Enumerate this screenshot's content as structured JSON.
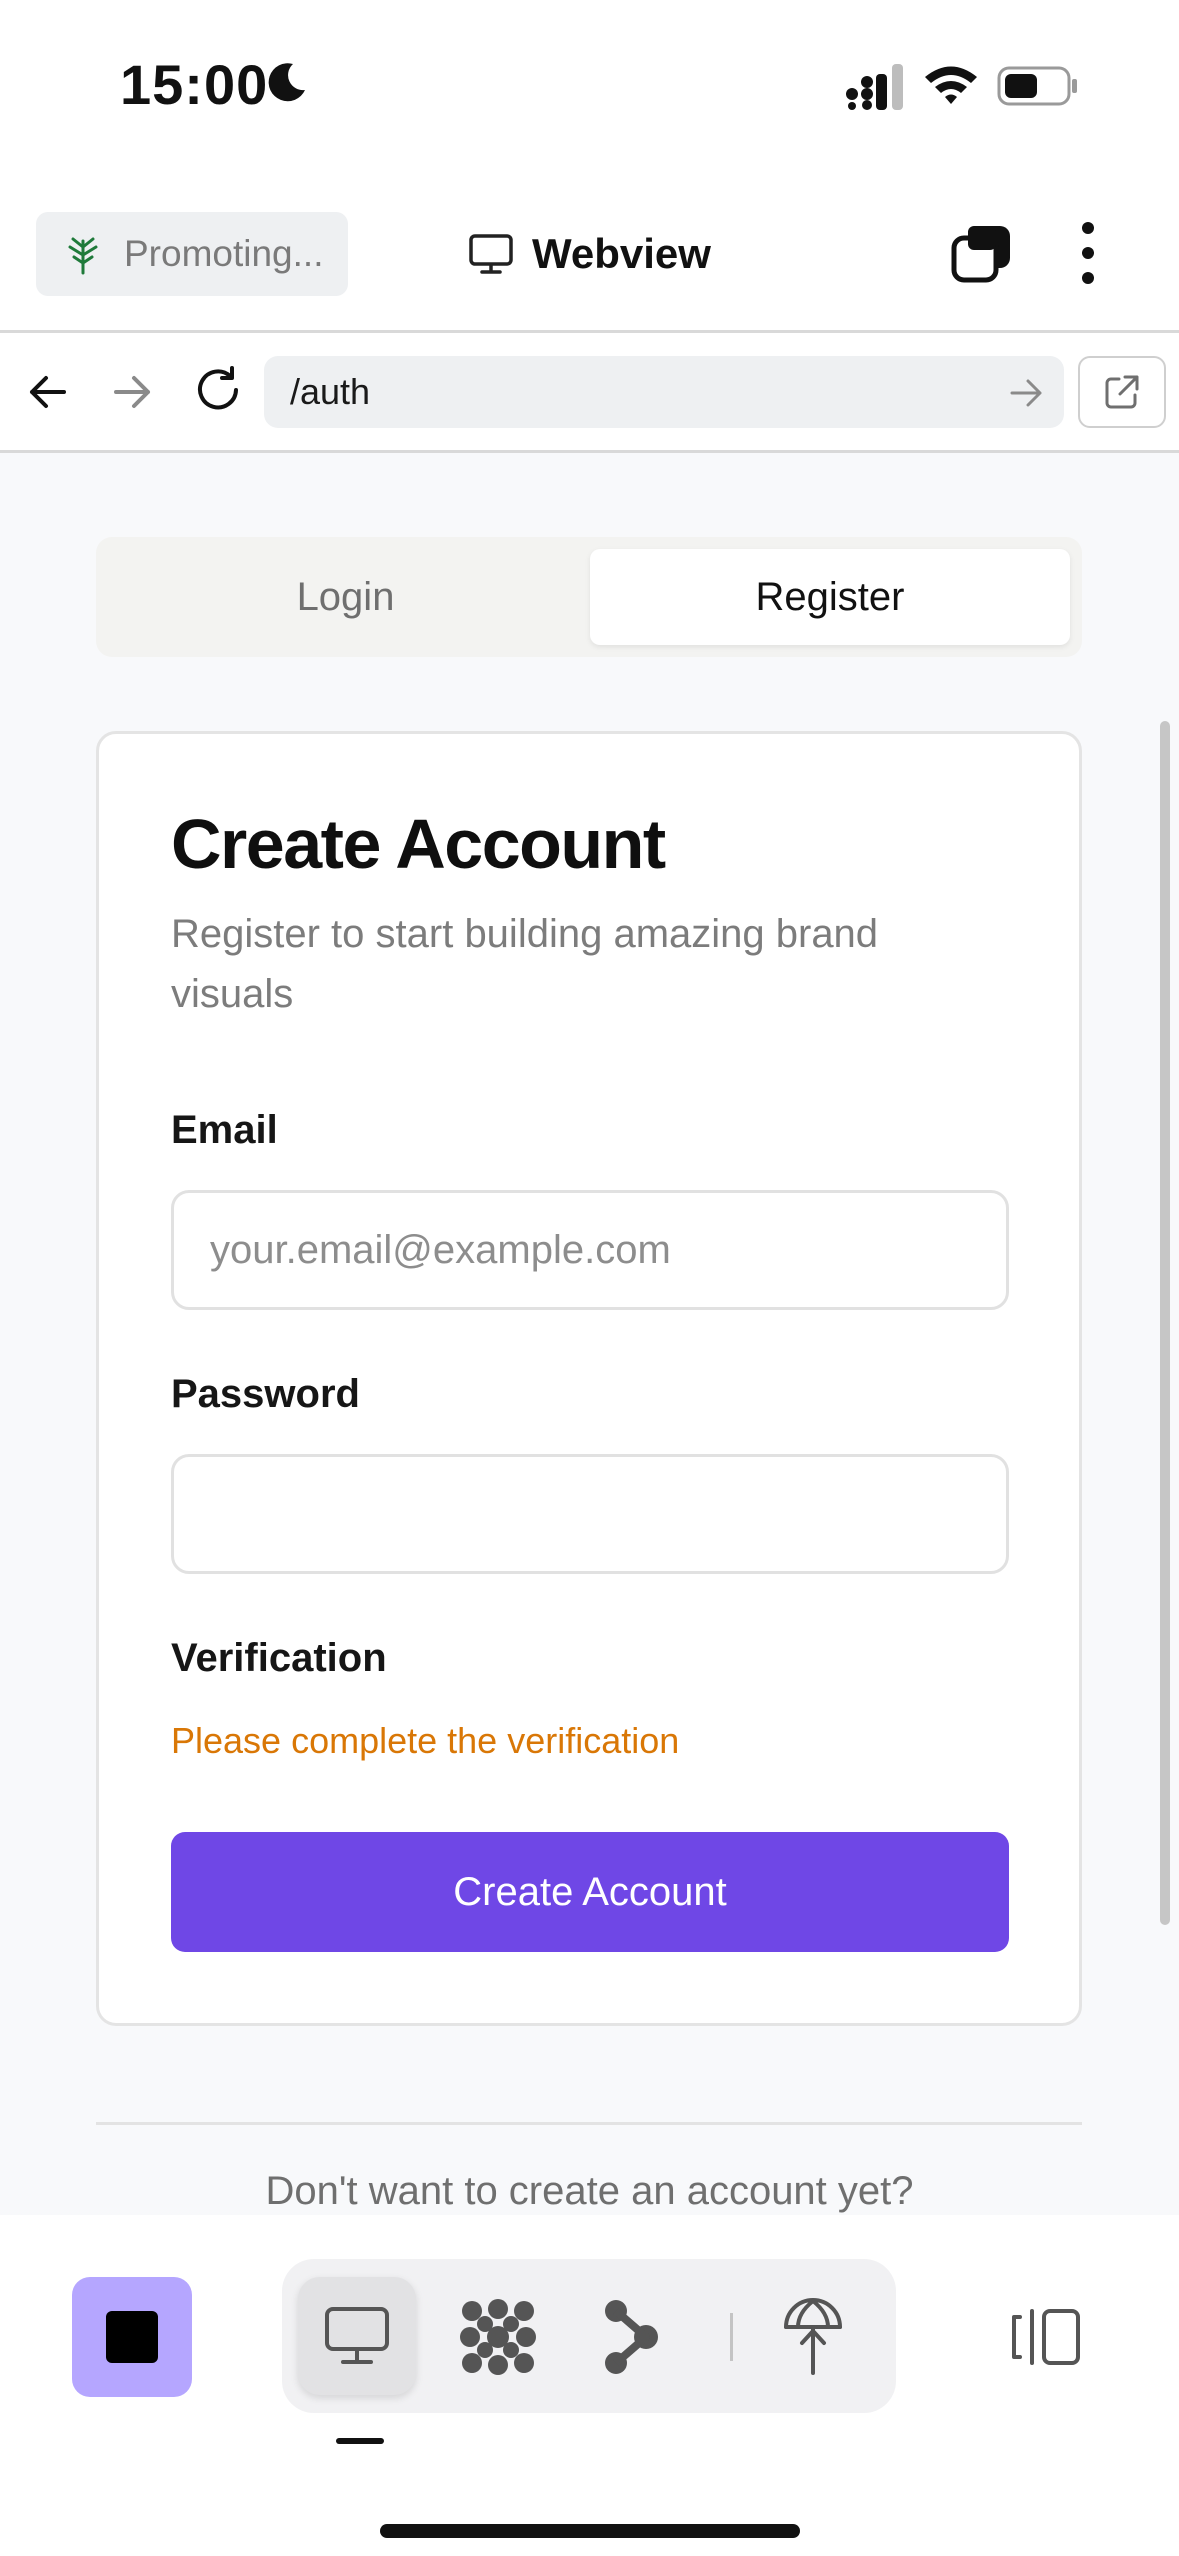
{
  "status_bar": {
    "time": "15:00",
    "icons": [
      "moon-icon",
      "signal-icon",
      "wifi-icon",
      "battery-icon"
    ]
  },
  "toolbar": {
    "promo_label": "Promoting...",
    "promo_icon": "tree-icon",
    "title": "Webview",
    "title_icon": "monitor-icon",
    "tabs_icon": "tabs-icon",
    "more_icon": "more-vertical-icon"
  },
  "url_bar": {
    "url": "/auth",
    "back_icon": "arrow-left-icon",
    "forward_icon": "arrow-right-icon",
    "reload_icon": "reload-icon",
    "go_icon": "arrow-right-icon",
    "external_icon": "external-link-icon"
  },
  "auth": {
    "tabs": [
      {
        "label": "Login",
        "active": false
      },
      {
        "label": "Register",
        "active": true
      }
    ],
    "card": {
      "title": "Create Account",
      "subtitle": "Register to start building amazing brand visuals",
      "email_label": "Email",
      "email_placeholder": "your.email@example.com",
      "email_value": "",
      "password_label": "Password",
      "password_value": "",
      "verification_label": "Verification",
      "verification_warning": "Please complete the verification",
      "submit_label": "Create Account"
    },
    "guest_prompt": "Don't want to create an account yet?"
  },
  "dock": {
    "stop_icon": "stop-icon",
    "modes": [
      {
        "icon": "monitor-icon",
        "active": true
      },
      {
        "icon": "grid-dots-icon",
        "active": false
      },
      {
        "icon": "flow-icon",
        "active": false
      },
      {
        "icon": "deploy-icon",
        "active": false
      }
    ],
    "panel_icon": "panel-toggle-icon"
  },
  "colors": {
    "accent": "#6f47e6",
    "stop_button": "#b5a6ff",
    "warning": "#d97706",
    "content_bg": "#f8f9fb"
  }
}
